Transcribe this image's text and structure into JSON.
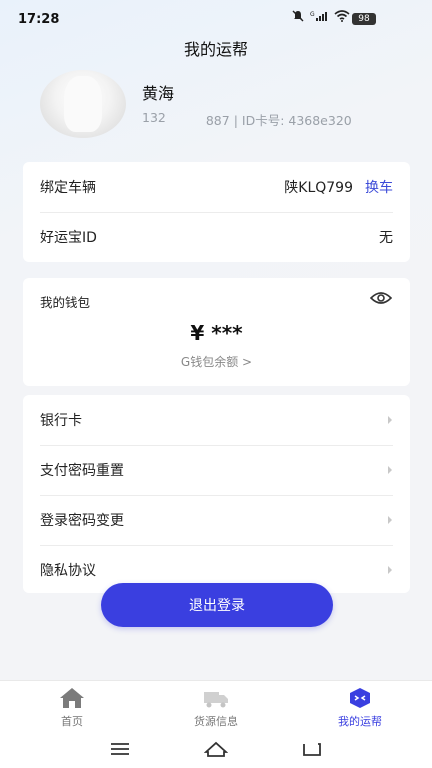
{
  "status_bar": {
    "time": "17:28",
    "battery": "98",
    "signal_text": "G"
  },
  "page": {
    "title": "我的运帮"
  },
  "profile": {
    "name": "黄海",
    "phone_prefix": "132",
    "phone_suffix_id": "887 | ID卡号: 4368e320"
  },
  "vehicle_card": {
    "bind_label": "绑定车辆",
    "plate": "陕KLQ799",
    "change_label": "换车",
    "yunbao_label": "好运宝ID",
    "yunbao_value": "无"
  },
  "wallet": {
    "title": "我的钱包",
    "amount": "¥ ***",
    "balance_link": "G钱包余额 >"
  },
  "menu": {
    "items": [
      {
        "label": "银行卡"
      },
      {
        "label": "支付密码重置"
      },
      {
        "label": "登录密码变更"
      },
      {
        "label": "隐私协议"
      }
    ]
  },
  "logout": {
    "label": "退出登录"
  },
  "tabbar": {
    "tabs": [
      {
        "label": "首页",
        "icon": "home-icon"
      },
      {
        "label": "货源信息",
        "icon": "truck-icon"
      },
      {
        "label": "我的运帮",
        "icon": "profile-badge-icon"
      }
    ],
    "active_index": 2
  },
  "colors": {
    "accent": "#3a3fe0",
    "link": "#3c4bd8",
    "muted": "#9aa0a8"
  }
}
